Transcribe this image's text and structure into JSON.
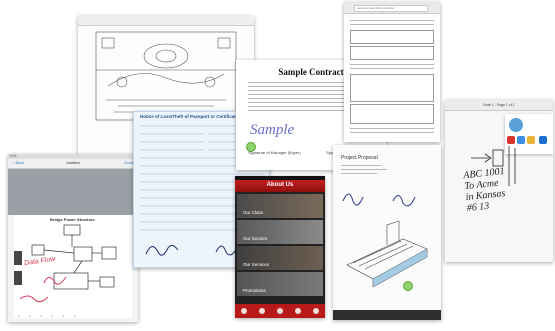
{
  "tech_drawing": {
    "name": "technical-drawing-document"
  },
  "ipad": {
    "status_time": "9:41",
    "nav_back": "< Back",
    "nav_title": "Untitled",
    "nav_action": "Done",
    "diagram_title": "Bridge Power Structure",
    "handwriting": "Data Flow"
  },
  "form": {
    "title": "Notice of Loss/Theft of Passport or Certificate (Green Form)"
  },
  "contract": {
    "title": "Sample Contract",
    "scribble": "Sample",
    "signer_a": "Signature of Manager (Buyer)",
    "signer_b": "Signature of Seller"
  },
  "phone": {
    "title": "About Us",
    "tiles": [
      "Our Class",
      "Our Doctors",
      "Our Services",
      "Promotions"
    ]
  },
  "browser": {
    "url": "www.contract-form.com/doc"
  },
  "proposal": {
    "title": "Project Proposal"
  },
  "note": {
    "header": "Note 1 - Page 1 of 1",
    "handwriting": "ABC 1001\nTo Acme\nin Kansas\n#6 13"
  }
}
